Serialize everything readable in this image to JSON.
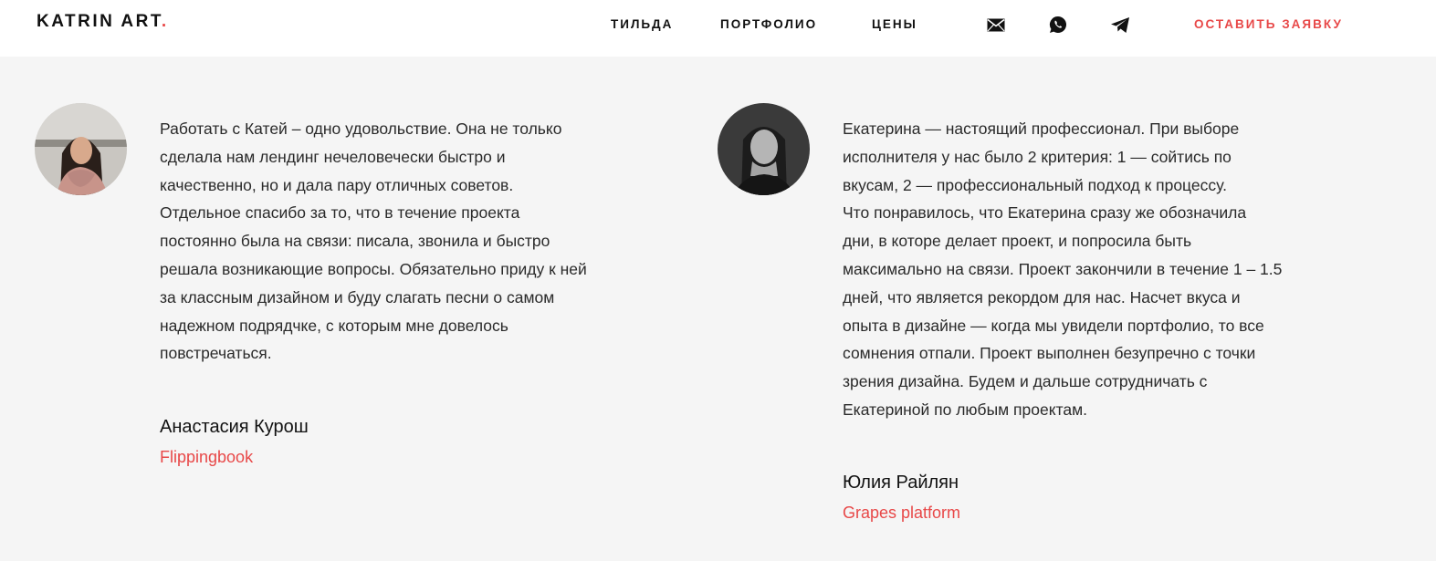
{
  "header": {
    "logo_text": "KATRIN ART",
    "logo_dot": ".",
    "accent_color": "#e84848",
    "nav": [
      {
        "label": "ТИЛЬДА"
      },
      {
        "label": "ПОРТФОЛИО"
      },
      {
        "label": "ЦЕНЫ"
      }
    ],
    "icons": [
      "mail-icon",
      "whatsapp-icon",
      "telegram-icon"
    ],
    "cta_label": "ОСТАВИТЬ ЗАЯВКУ"
  },
  "reviews": [
    {
      "text": "Работать с Катей – одно удовольствие. Она не только\nсделала нам лендинг нечеловечески быстро и\nкачественно, но и дала пару отличных советов.\nОтдельное спасибо за то, что в течение проекта\nпостоянно была на связи: писала, звонила и быстро\nрешала возникающие вопросы. Обязательно приду к ней\nза классным дизайном и буду слагать песни о самом\nнадежном подрядчке, с которым мне довелось\nповстречаться.",
      "name": "Анастасия Курош",
      "company": "Flippingbook"
    },
    {
      "text": "Екатерина — настоящий профессионал. При выборе\nисполнителя у нас было 2 критерия: 1 — сойтись по\nвкусам, 2 — профессиональный подход к процессу.\nЧто понравилось, что Екатерина сразу же обозначила\nдни, в которе делает проект, и попросила быть\nмаксимально на связи. Проект закончили в течение 1 – 1.5\nдней, что является рекордом для нас. Насчет вкуса и\nопыта в дизайне — когда мы увидели портфолио, то все\nсомнения отпали. Проект выполнен безупречно с точки\nзрения дизайна. Будем и дальше сотрудничать с\nЕкатериной по любым проектам.",
      "name": "Юлия Райлян",
      "company": "Grapes platform"
    }
  ]
}
